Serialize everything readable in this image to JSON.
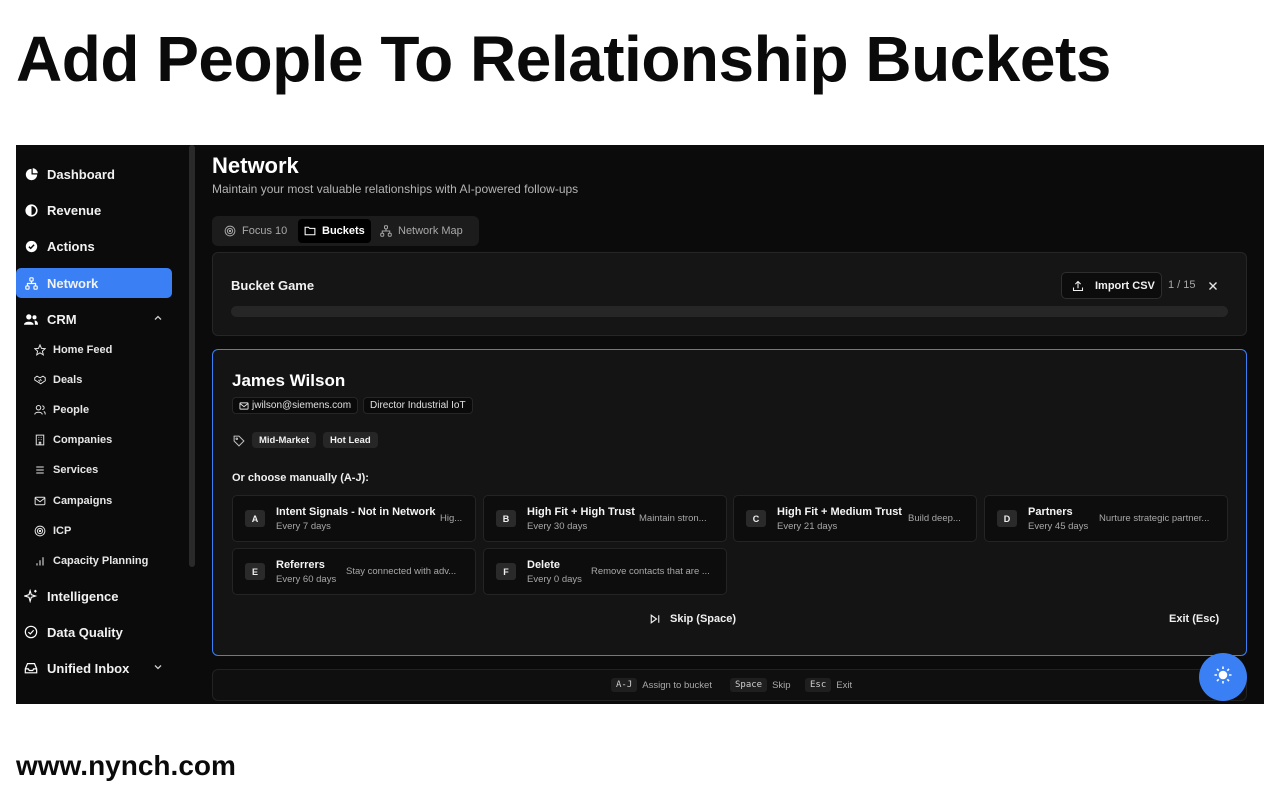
{
  "headline": "Add People To Relationship Buckets",
  "footer_url": "www.nynch.com",
  "sidebar": {
    "items": [
      {
        "label": "Dashboard",
        "icon": "pie-chart-icon"
      },
      {
        "label": "Revenue",
        "icon": "revenue-icon"
      },
      {
        "label": "Actions",
        "icon": "check-circle-icon"
      },
      {
        "label": "Network",
        "icon": "network-icon",
        "active": true
      },
      {
        "label": "CRM",
        "icon": "users-icon",
        "expanded": true
      },
      {
        "label": "Intelligence",
        "icon": "sparkles-icon"
      },
      {
        "label": "Data Quality",
        "icon": "check-badge-icon"
      },
      {
        "label": "Unified Inbox",
        "icon": "inbox-icon"
      }
    ],
    "crm_sub": [
      {
        "label": "Home Feed",
        "icon": "star-icon"
      },
      {
        "label": "Deals",
        "icon": "handshake-icon"
      },
      {
        "label": "People",
        "icon": "people-icon"
      },
      {
        "label": "Companies",
        "icon": "building-icon"
      },
      {
        "label": "Services",
        "icon": "list-icon"
      },
      {
        "label": "Campaigns",
        "icon": "mail-icon"
      },
      {
        "label": "ICP",
        "icon": "target-icon"
      },
      {
        "label": "Capacity Planning",
        "icon": "bar-chart-icon"
      }
    ]
  },
  "main": {
    "title": "Network",
    "subtitle": "Maintain your most valuable relationships with AI-powered follow-ups",
    "tabs": [
      {
        "label": "Focus 10",
        "icon": "target-icon"
      },
      {
        "label": "Buckets",
        "icon": "folder-icon",
        "active": true
      },
      {
        "label": "Network Map",
        "icon": "network-icon"
      }
    ]
  },
  "bucket_game": {
    "title": "Bucket Game",
    "import_label": "Import CSV",
    "counter": "1 / 15",
    "progress": 0.0
  },
  "person": {
    "name": "James Wilson",
    "email": "jwilson@siemens.com",
    "title": "Director Industrial IoT",
    "tags": [
      "Mid-Market",
      "Hot Lead"
    ]
  },
  "choose_label": "Or choose manually (A-J):",
  "buckets": [
    {
      "key": "A",
      "name": "Intent Signals - Not in Network",
      "frequency": "Every 7 days",
      "description": "Hig..."
    },
    {
      "key": "B",
      "name": "High Fit + High Trust",
      "frequency": "Every 30 days",
      "description": "Maintain stron..."
    },
    {
      "key": "C",
      "name": "High Fit + Medium Trust",
      "frequency": "Every 21 days",
      "description": "Build deep..."
    },
    {
      "key": "D",
      "name": "Partners",
      "frequency": "Every 45 days",
      "description": "Nurture strategic partner..."
    },
    {
      "key": "E",
      "name": "Referrers",
      "frequency": "Every 60 days",
      "description": "Stay connected with adv..."
    },
    {
      "key": "F",
      "name": "Delete",
      "frequency": "Every 0 days",
      "description": "Remove contacts that are ..."
    }
  ],
  "actions": {
    "skip": "Skip (Space)",
    "exit": "Exit (Esc)"
  },
  "shortcuts": [
    {
      "key": "A-J",
      "label": "Assign to bucket"
    },
    {
      "key": "Space",
      "label": "Skip"
    },
    {
      "key": "Esc",
      "label": "Exit"
    }
  ],
  "colors": {
    "accent": "#3b7ff5",
    "background": "#0b0b0b",
    "panel": "#151515"
  }
}
